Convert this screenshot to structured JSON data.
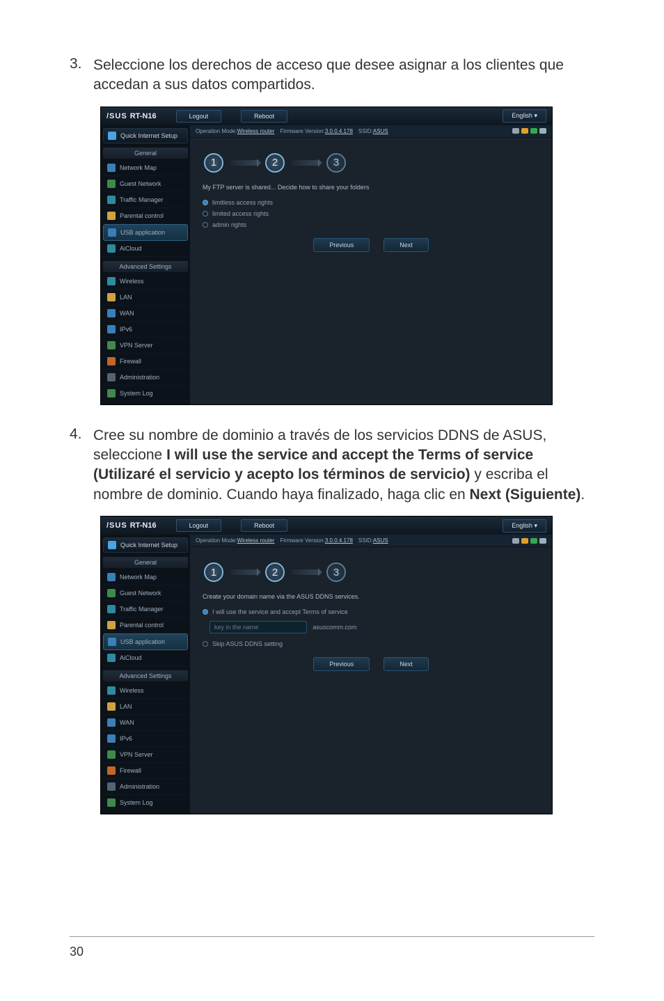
{
  "page_number": "30",
  "step3": {
    "num": "3.",
    "text": "Seleccione los derechos de acceso que desee asignar a los clientes que accedan a sus datos compartidos."
  },
  "step4": {
    "num": "4.",
    "prefix": "Cree su nombre de dominio a través de los servicios DDNS de ASUS, seleccione ",
    "bold1": "I will use the service and accept the Terms of service (Utilizaré el servicio y acepto los términos de servicio)",
    "mid": " y escriba el nombre de dominio. Cuando haya finalizado, haga clic en ",
    "bold2": "Next (Siguiente)",
    "suffix": "."
  },
  "router": {
    "logo": "/SUS",
    "model": "RT-N16",
    "logout": "Logout",
    "reboot": "Reboot",
    "lang": "English",
    "info_mode_label": "Operation Mode: ",
    "info_mode": "Wireless router",
    "info_fw_label": "Firmware Version: ",
    "info_fw": "3.0.0.4.178",
    "info_ssid_label": "SSID: ",
    "info_ssid": "ASUS",
    "qis": "Quick Internet Setup",
    "hdr_general": "General",
    "hdr_advanced": "Advanced Settings",
    "nav": {
      "network_map": "Network Map",
      "guest_network": "Guest Network",
      "traffic_manager": "Traffic Manager",
      "parental_control": "Parental control",
      "usb_application": "USB application",
      "aicloud": "AiCloud",
      "wireless": "Wireless",
      "lan": "LAN",
      "wan": "WAN",
      "ipv6": "IPv6",
      "vpn_server": "VPN Server",
      "firewall": "Firewall",
      "administration": "Administration",
      "system_log": "System Log"
    },
    "btn_prev": "Previous",
    "btn_next": "Next",
    "circles": {
      "c1": "1",
      "c2": "2",
      "c3": "3"
    }
  },
  "shot3": {
    "desc": "My FTP server is shared... Decide how to share your folders",
    "opt1": "limitless access rights",
    "opt2": "limited access rights",
    "opt3": "admin rights"
  },
  "shot4": {
    "desc": "Create your domain name via the ASUS DDNS services.",
    "opt_use": "I will use the service and accept Terms of service",
    "input_placeholder": "key in the name",
    "suffix": ".asuscomm.com",
    "opt_skip": "Skip ASUS DDNS setting"
  }
}
